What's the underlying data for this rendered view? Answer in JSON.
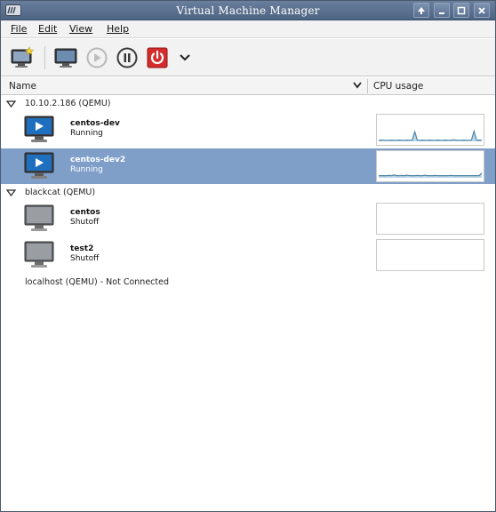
{
  "window": {
    "title": "Virtual Machine Manager"
  },
  "menubar": {
    "items": [
      {
        "label": "File"
      },
      {
        "label": "Edit"
      },
      {
        "label": "View"
      },
      {
        "label": "Help"
      }
    ]
  },
  "toolbar": {
    "buttons": [
      {
        "icon": "new-vm-icon"
      },
      {
        "icon": "open-console-icon"
      },
      {
        "icon": "run-icon",
        "enabled": false
      },
      {
        "icon": "pause-icon"
      },
      {
        "icon": "shutdown-icon"
      },
      {
        "icon": "chevron-down-icon"
      }
    ]
  },
  "columns": {
    "name": "Name",
    "cpu": "CPU usage"
  },
  "connections": [
    {
      "label": "10.10.2.186 (QEMU)",
      "expanded": true,
      "vms": [
        {
          "name": "centos-dev",
          "status": "Running",
          "selected": false,
          "cpu": [
            0.05,
            0.06,
            0.05,
            0.04,
            0.05,
            0.06,
            0.05,
            0.05,
            0.06,
            0.05,
            0.05,
            0.06,
            0.05,
            0.05,
            0.45,
            0.05,
            0.05,
            0.06,
            0.05,
            0.05,
            0.06,
            0.05,
            0.05,
            0.06,
            0.05,
            0.05,
            0.06,
            0.05,
            0.05,
            0.07,
            0.06,
            0.05,
            0.05,
            0.06,
            0.05,
            0.05,
            0.06,
            0.48,
            0.05,
            0.06,
            0.05
          ]
        },
        {
          "name": "centos-dev2",
          "status": "Running",
          "selected": true,
          "cpu": [
            0.1,
            0.1,
            0.1,
            0.1,
            0.11,
            0.1,
            0.13,
            0.1,
            0.1,
            0.11,
            0.1,
            0.12,
            0.1,
            0.1,
            0.1,
            0.11,
            0.1,
            0.1,
            0.12,
            0.1,
            0.1,
            0.1,
            0.11,
            0.1,
            0.1,
            0.1,
            0.1,
            0.1,
            0.11,
            0.1,
            0.1,
            0.1,
            0.1,
            0.1,
            0.1,
            0.1,
            0.1,
            0.1,
            0.1,
            0.1,
            0.22
          ]
        }
      ]
    },
    {
      "label": "blackcat (QEMU)",
      "expanded": true,
      "vms": [
        {
          "name": "centos",
          "status": "Shutoff",
          "selected": false,
          "cpu": []
        },
        {
          "name": "test2",
          "status": "Shutoff",
          "selected": false,
          "cpu": []
        }
      ]
    },
    {
      "label": "localhost (QEMU) - Not Connected",
      "expanded": false,
      "vms": []
    }
  ],
  "colors": {
    "selection": "#7f9fc9",
    "graph_line": "#4f86a8",
    "graph_fill": "#bcd6e6",
    "shutdown_red": "#d42b2b"
  }
}
